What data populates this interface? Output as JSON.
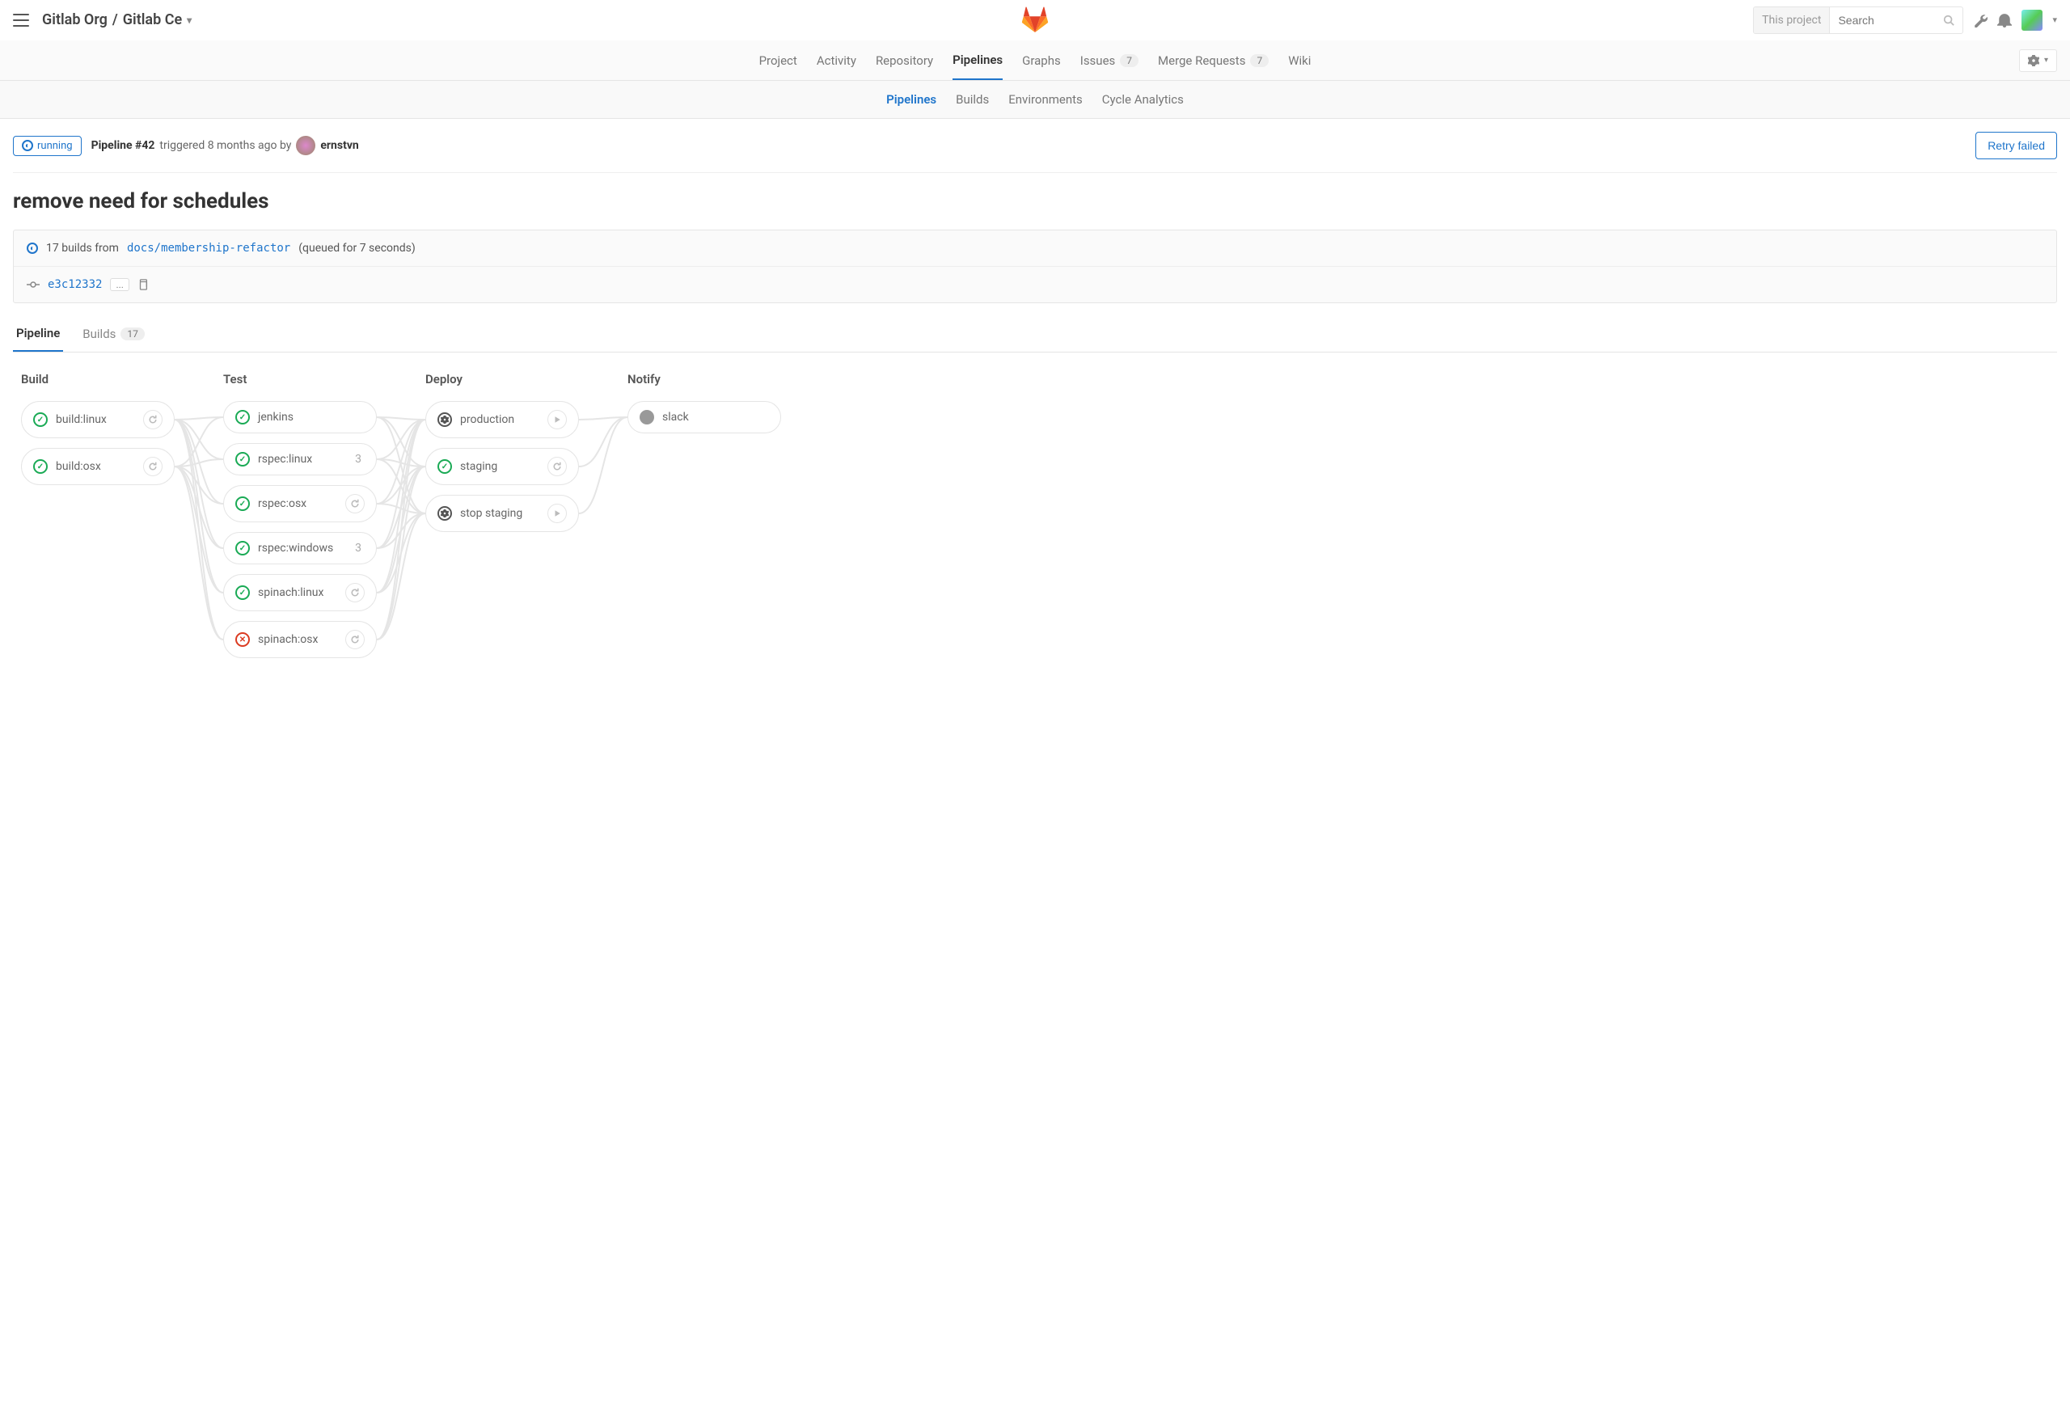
{
  "breadcrumb": {
    "org": "Gitlab Org",
    "project": "Gitlab Ce"
  },
  "search": {
    "scope": "This project",
    "placeholder": "Search"
  },
  "proj_nav": {
    "project": "Project",
    "activity": "Activity",
    "repository": "Repository",
    "pipelines": "Pipelines",
    "graphs": "Graphs",
    "issues": "Issues",
    "issues_count": "7",
    "merge_requests": "Merge Requests",
    "mr_count": "7",
    "wiki": "Wiki"
  },
  "sub_nav": {
    "pipelines": "Pipelines",
    "builds": "Builds",
    "environments": "Environments",
    "cycle": "Cycle Analytics"
  },
  "pipeline": {
    "status": "running",
    "id_label": "Pipeline #42",
    "triggered": "triggered 8 months ago by",
    "author": "ernstvn",
    "retry": "Retry failed",
    "commit_title": "remove need for schedules",
    "builds_count_text": "17 builds from",
    "branch": "docs/membership-refactor",
    "queued": "(queued for 7 seconds)",
    "sha": "e3c12332",
    "sha_more": "..."
  },
  "pl_tabs": {
    "pipeline": "Pipeline",
    "builds": "Builds",
    "builds_count": "17"
  },
  "stages": [
    {
      "name": "Build",
      "jobs": [
        {
          "name": "build:linux",
          "status": "success",
          "action": "retry"
        },
        {
          "name": "build:osx",
          "status": "success",
          "action": "retry"
        }
      ]
    },
    {
      "name": "Test",
      "jobs": [
        {
          "name": "jenkins",
          "status": "success"
        },
        {
          "name": "rspec:linux",
          "status": "success",
          "count": "3"
        },
        {
          "name": "rspec:osx",
          "status": "success",
          "action": "retry"
        },
        {
          "name": "rspec:windows",
          "status": "success",
          "count": "3"
        },
        {
          "name": "spinach:linux",
          "status": "success",
          "action": "retry"
        },
        {
          "name": "spinach:osx",
          "status": "failed",
          "action": "retry"
        }
      ]
    },
    {
      "name": "Deploy",
      "jobs": [
        {
          "name": "production",
          "status": "manual",
          "action": "play"
        },
        {
          "name": "staging",
          "status": "success",
          "action": "retry"
        },
        {
          "name": "stop staging",
          "status": "manual",
          "action": "play"
        }
      ]
    },
    {
      "name": "Notify",
      "jobs": [
        {
          "name": "slack",
          "status": "skipped"
        }
      ]
    }
  ]
}
